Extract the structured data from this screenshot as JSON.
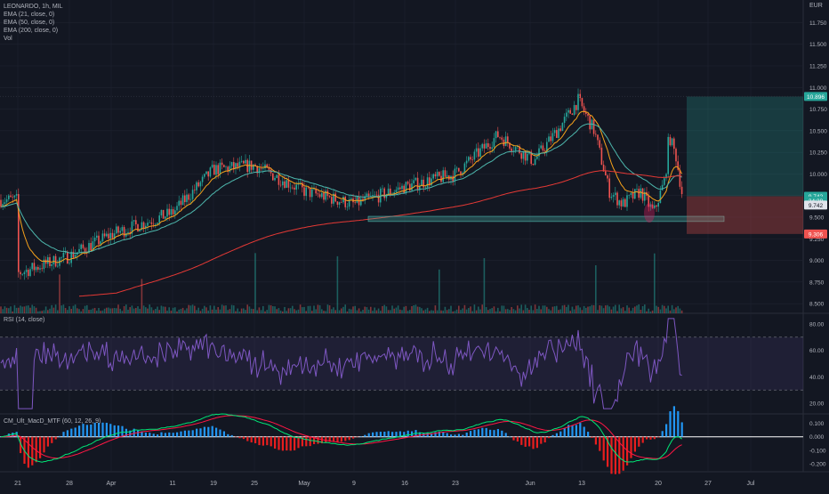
{
  "header": {
    "symbol_line": "LEONARDO, 1h, MIL",
    "indicators": [
      "EMA (21, close, 0)",
      "EMA (50, close, 0)",
      "EMA (200, close, 0)",
      "Vol"
    ],
    "currency": "EUR"
  },
  "colors": {
    "background": "#131722",
    "grid": "#1f2330",
    "up": "#26a69a",
    "down": "#ef5350",
    "ema21": "#f7a21b",
    "ema50": "#4db6ac",
    "ema200": "#e53935",
    "rsi": "#7e57c2",
    "macd_up": "#00e676",
    "macd_down": "#ff1744",
    "hist_up": "#2196f3",
    "hist_down": "#e91e1e",
    "target": "#26a69a",
    "stop": "#ef5350",
    "zone": "#4db6ac"
  },
  "chart_data": [
    {
      "type": "candlestick",
      "title": "LEONARDO, 1h, MIL",
      "ylabel": "EUR",
      "y_ticks": [
        "11.750",
        "11.500",
        "11.250",
        "11.000",
        "10.750",
        "10.500",
        "10.250",
        "10.000",
        "9.750",
        "9.500",
        "9.250",
        "9.000",
        "8.750",
        "8.500"
      ],
      "ylim": [
        8.45,
        11.95
      ],
      "x_ticks": [
        "21",
        "28",
        "Apr",
        "11",
        "19",
        "25",
        "May",
        "9",
        "16",
        "23",
        "Jun",
        "13",
        "20",
        "27",
        "Jul"
      ],
      "price_path": [
        [
          "21",
          8.85
        ],
        [
          "28",
          9.05
        ],
        [
          "Apr",
          9.3
        ],
        [
          "11",
          9.55
        ],
        [
          "19",
          10.05
        ],
        [
          "25",
          10.1
        ],
        [
          "May",
          9.8
        ],
        [
          "9",
          9.65
        ],
        [
          "16",
          9.85
        ],
        [
          "23",
          10.0
        ],
        [
          "Jun",
          10.1
        ],
        [
          "13",
          10.6
        ],
        [
          "20",
          9.55
        ],
        [
          "27",
          9.8
        ]
      ],
      "series": [
        {
          "name": "EMA (21, close, 0)"
        },
        {
          "name": "EMA (50, close, 0)"
        },
        {
          "name": "EMA (200, close, 0)"
        }
      ],
      "price_labels": [
        {
          "text": "10.896",
          "value": 10.896,
          "color": "#26a69a"
        },
        {
          "text": "9.742",
          "value": 9.742,
          "color": "#26a69a"
        },
        {
          "text": "34:28",
          "value": 9.688,
          "color": "#26a69a"
        },
        {
          "text": "9.742",
          "value": 9.64,
          "color": "#e0e3eb"
        },
        {
          "text": "9.306",
          "value": 9.306,
          "color": "#ef5350"
        }
      ],
      "support_zone": [
        9.45,
        9.51
      ],
      "position": {
        "target": 10.896,
        "entry": 9.742,
        "stop": 9.306
      }
    },
    {
      "type": "line",
      "title": "RSI (14, close)",
      "y_ticks": [
        "80.00",
        "60.00",
        "40.00",
        "20.00"
      ],
      "ylim": [
        12,
        88
      ],
      "band": [
        30,
        70
      ]
    },
    {
      "type": "area",
      "title": "CM_Ult_MacD_MTF (60, 12, 26, 9)",
      "y_ticks": [
        "0.100",
        "0.000",
        "-0.100",
        "-0.200"
      ],
      "ylim": [
        -0.26,
        0.17
      ]
    }
  ]
}
